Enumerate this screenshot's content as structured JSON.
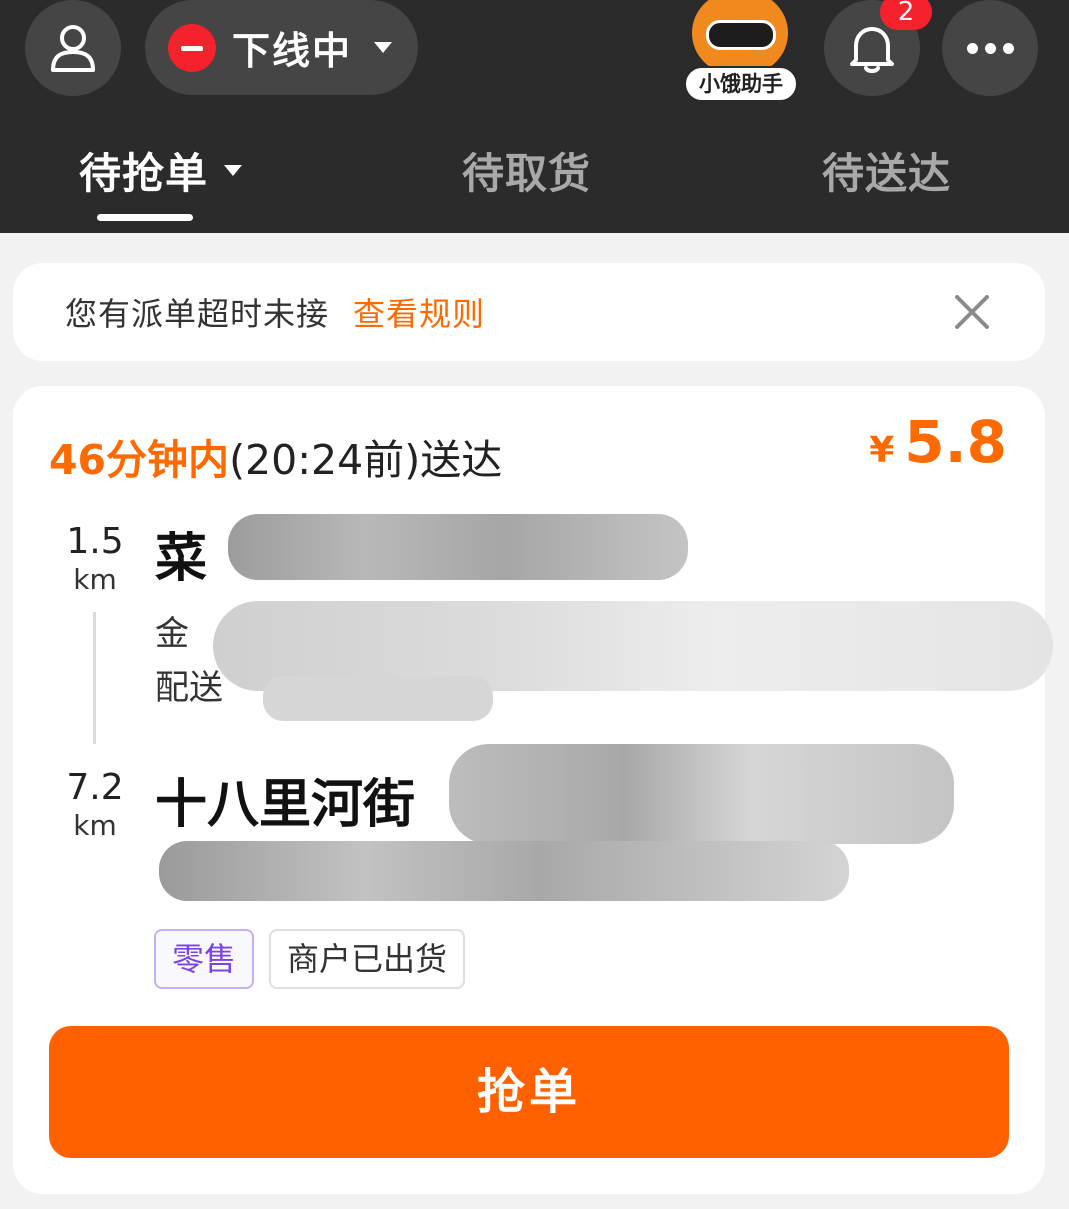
{
  "header": {
    "status": {
      "label": "下线中",
      "color": "#f5222d"
    },
    "assistant_label": "小饿助手",
    "notification_count": "2",
    "icons": {
      "profile": "user-icon",
      "bell": "bell-icon",
      "more": "more-dots-icon"
    }
  },
  "tabs": [
    {
      "label": "待抢单",
      "active": true
    },
    {
      "label": "待取货",
      "active": false
    },
    {
      "label": "待送达",
      "active": false
    }
  ],
  "notice": {
    "text": "您有派单超时未接",
    "link": "查看规则"
  },
  "order": {
    "deadline_highlight": "46分钟内",
    "deadline_rest": "(20:24前)送达",
    "price_currency": "¥",
    "price_amount": "5.8",
    "pickup": {
      "distance": "1.5",
      "unit": "km",
      "name_visible": "菜",
      "line1_visible": "金",
      "line2_visible": "配送"
    },
    "dropoff": {
      "distance": "7.2",
      "unit": "km",
      "name_visible": "十八里河街"
    },
    "tags": [
      "零售",
      "商户已出货"
    ],
    "grab_button": "抢单"
  },
  "colors": {
    "accent": "#ff6100",
    "header_bg": "#2b2b2b",
    "retail_tag": "#7a43e6"
  }
}
